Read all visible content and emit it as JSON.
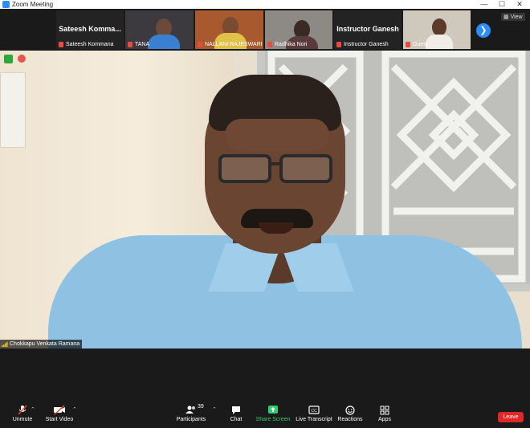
{
  "window": {
    "title": "Zoom Meeting"
  },
  "strip": {
    "tiles": [
      {
        "big_name": "Sateesh Komma...",
        "label": "Sateesh Kommana"
      },
      {
        "big_name": "",
        "label": "TANA"
      },
      {
        "big_name": "",
        "label": "NALLANI RAJESWARI"
      },
      {
        "big_name": "",
        "label": "Radhika Nori"
      },
      {
        "big_name": "Instructor Ganesh",
        "label": "Instructor Ganesh"
      },
      {
        "big_name": "",
        "label": "Guest"
      }
    ],
    "view_label": "View"
  },
  "main_video": {
    "speaker_name": "Chokkapu Venkata Ramana"
  },
  "toolbar": {
    "unmute": "Unmute",
    "start_video": "Start Video",
    "participants": "Participants",
    "participant_count": "39",
    "chat": "Chat",
    "share_screen": "Share Screen",
    "live_transcript": "Live Transcript",
    "reactions": "Reactions",
    "apps": "Apps",
    "leave": "Leave"
  },
  "colors": {
    "accent": "#2d8cff",
    "share_green": "#2ecc71",
    "leave_red": "#e02828",
    "muted_red": "#e74c3c"
  }
}
